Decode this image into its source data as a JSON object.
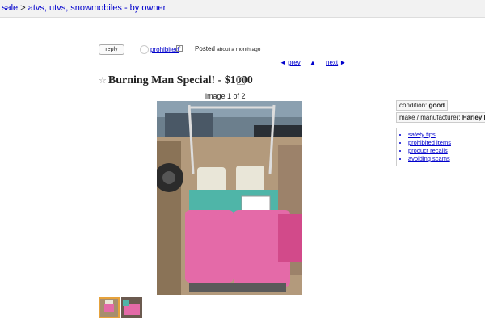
{
  "breadcrumb": {
    "part1": "sale",
    "separator": " > ",
    "part2": "atvs, utvs, snowmobiles - by owner"
  },
  "actions": {
    "reply_label": "reply",
    "prohibited_label": "prohibited",
    "posted_label": "Posted",
    "posted_ago": "about a month ago"
  },
  "nav": {
    "prev_label": "prev",
    "prev_arrow": "◄",
    "up_arrow": "▲",
    "next_label": "next",
    "next_arrow": "►"
  },
  "listing": {
    "star": "☆",
    "title": "Burning Man Special! - $1000",
    "image_counter": "image 1 of 2"
  },
  "attributes": [
    {
      "label": "condition:",
      "value": "good"
    },
    {
      "label": "make / manufacturer:",
      "value": "Harley D"
    }
  ],
  "safety_links": [
    "safety tips",
    "prohibited items",
    "product recalls",
    "avoiding scams"
  ],
  "colors": {
    "link": "#0000cc",
    "thumb_selected_border": "#e6a23c"
  }
}
